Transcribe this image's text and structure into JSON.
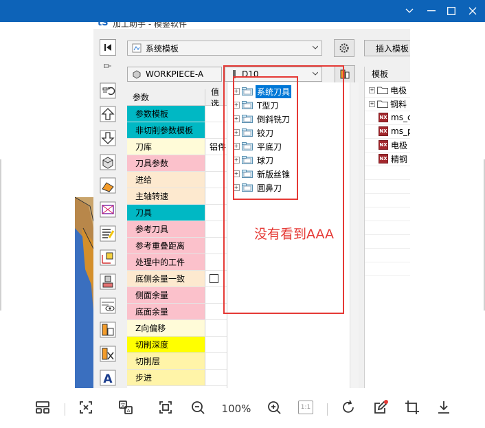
{
  "app": {
    "title": "加工助手 - 模鉴软件",
    "logo": "tS"
  },
  "toolbar": {
    "template_system": "系统模板",
    "workpiece": "WORKPIECE-A",
    "tool": "D10",
    "insert_template": "插入模板"
  },
  "params": {
    "header_param": "参数",
    "header_value": "值选",
    "rows": [
      {
        "name": "参数模板",
        "value": "",
        "color": "#00b8c4"
      },
      {
        "name": "非切削参数模板",
        "value": "",
        "color": "#00b8c4"
      },
      {
        "name": "刀库",
        "value": "铝件",
        "color": "#fffbd8"
      },
      {
        "name": "刀具参数",
        "value": "",
        "color": "#fbc1cb"
      },
      {
        "name": "进给",
        "value": "",
        "color": "#fde9cf"
      },
      {
        "name": "主轴转速",
        "value": "",
        "color": "#fde9cf"
      },
      {
        "name": "刀具",
        "value": "",
        "color": "#00b8c4"
      },
      {
        "name": "参考刀具",
        "value": "",
        "color": "#fbc1cb"
      },
      {
        "name": "参考重叠距离",
        "value": "",
        "color": "#fbc1cb"
      },
      {
        "name": "处理中的工件",
        "value": "",
        "color": "#fbc1cb"
      },
      {
        "name": "底侧余量一致",
        "value": "checkbox",
        "color": "#fde9cf"
      },
      {
        "name": "侧面余量",
        "value": "",
        "color": "#fbc1cb"
      },
      {
        "name": "底面余量",
        "value": "",
        "color": "#fbc1cb"
      },
      {
        "name": "Z向偏移",
        "value": "",
        "color": "#fffbd8"
      },
      {
        "name": "切削深度",
        "value": "",
        "color": "#ffff00"
      },
      {
        "name": "切削层",
        "value": "",
        "color": "#fff4a8"
      },
      {
        "name": "步进",
        "value": "",
        "color": "#fff4a8"
      }
    ]
  },
  "tool_tree": {
    "items": [
      "系统刀具",
      "T型刀",
      "倒斜铣刀",
      "铰刀",
      "平底刀",
      "球刀",
      "新版丝锥",
      "圆鼻刀"
    ],
    "selected_index": 0
  },
  "annotation": {
    "text": "没有看到AAA",
    "color": "#e53935"
  },
  "template_tree": {
    "header": "模板",
    "folders": [
      "电极",
      "钢料"
    ],
    "files": [
      "ms_c",
      "ms_p",
      "电极",
      "精钢"
    ]
  },
  "viewer": {
    "zoom": "100%",
    "ratio_label": "1:1"
  }
}
